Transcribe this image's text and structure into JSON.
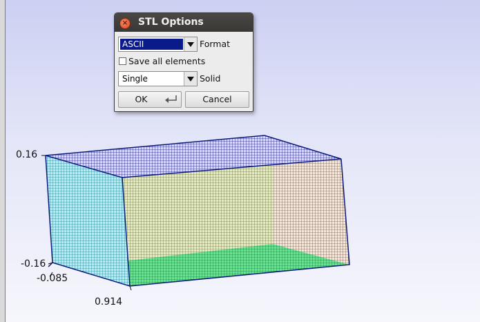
{
  "axes": {
    "z_top": "0.16",
    "z_bottom": "-0.16",
    "y_label": "-0.085",
    "x_label": "0.914"
  },
  "dialog": {
    "title": "STL Options",
    "format_value": "ASCII",
    "format_label": "Format",
    "save_all_label": "Save all elements",
    "save_all_checked": false,
    "solid_value": "Single",
    "solid_label": "Solid",
    "ok_label": "OK",
    "cancel_label": "Cancel"
  },
  "icons": [
    "close-icon",
    "dropdown-arrow-icon",
    "enter-key-icon"
  ],
  "colors": {
    "titlebar": "#3e3c39",
    "close": "#e05a2e",
    "selection": "#0a1a8a",
    "mesh_edge": "#0a1a7a"
  }
}
